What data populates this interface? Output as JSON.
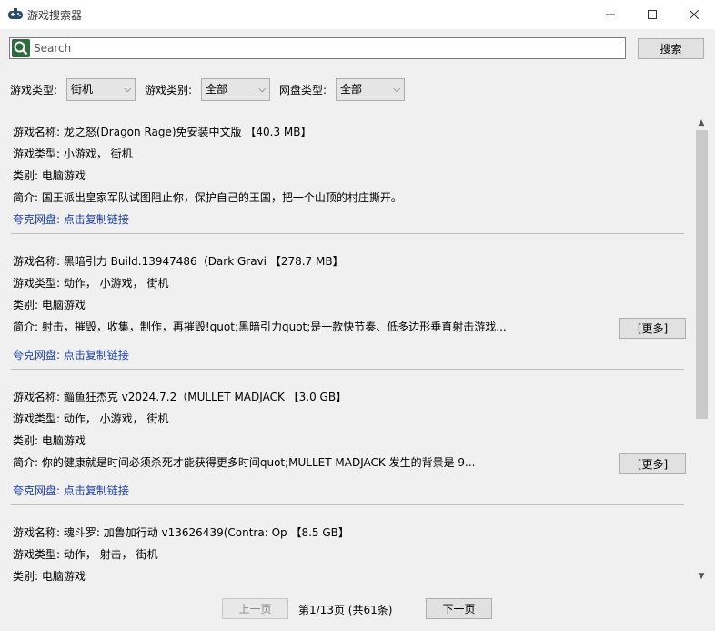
{
  "window": {
    "title": "游戏搜索器"
  },
  "search": {
    "placeholder": "Search",
    "button_label": "搜索"
  },
  "filters": [
    {
      "label": "游戏类型:",
      "value": "街机"
    },
    {
      "label": "游戏类别:",
      "value": "全部"
    },
    {
      "label": "网盘类型:",
      "value": "全部"
    }
  ],
  "games": [
    {
      "name": "游戏名称: 龙之怒(Dragon Rage)免安装中文版 【40.3 MB】",
      "type": "游戏类型: 小游戏， 街机",
      "category": "类别: 电脑游戏",
      "intro": "简介: 国王派出皇家军队试图阻止你，保护自己的王国，把一个山顶的村庄撕开。",
      "link": "夸克网盘: 点击复制链接",
      "more": ""
    },
    {
      "name": "游戏名称: 黑暗引力 Build.13947486（Dark Gravi 【278.7 MB】",
      "type": "游戏类型:  动作， 小游戏， 街机",
      "category": "类别: 电脑游戏",
      "intro": "简介:  射击，摧毁，收集，制作，再摧毁!quot;黑暗引力quot;是一款快节奏、低多边形垂直射击游戏...",
      "link": "夸克网盘: 点击复制链接",
      "more": "[更多]"
    },
    {
      "name": "游戏名称: 鲻鱼狂杰克 v2024.7.2（MULLET MADJACK 【3.0 GB】",
      "type": "游戏类型:  动作， 小游戏， 街机",
      "category": "类别: 电脑游戏",
      "intro": "简介:  你的健康就是时间必须杀死才能获得更多时间quot;MULLET MADJACK 发生的背景是 9...",
      "link": "夸克网盘: 点击复制链接",
      "more": "[更多]"
    },
    {
      "name": "游戏名称: 魂斗罗: 加鲁加行动 v13626439(Contra: Op 【8.5 GB】",
      "type": "游戏类型:  动作， 射击， 街机",
      "category": "类别: 电脑游戏",
      "intro": "",
      "link": "",
      "more": ""
    }
  ],
  "pagination": {
    "prev_label": "上一页",
    "page_info": "第1/13页 (共61条)",
    "next_label": "下一页"
  },
  "colors": {
    "link": "#1b3fa8",
    "icon_green": "#2e6b3a"
  }
}
